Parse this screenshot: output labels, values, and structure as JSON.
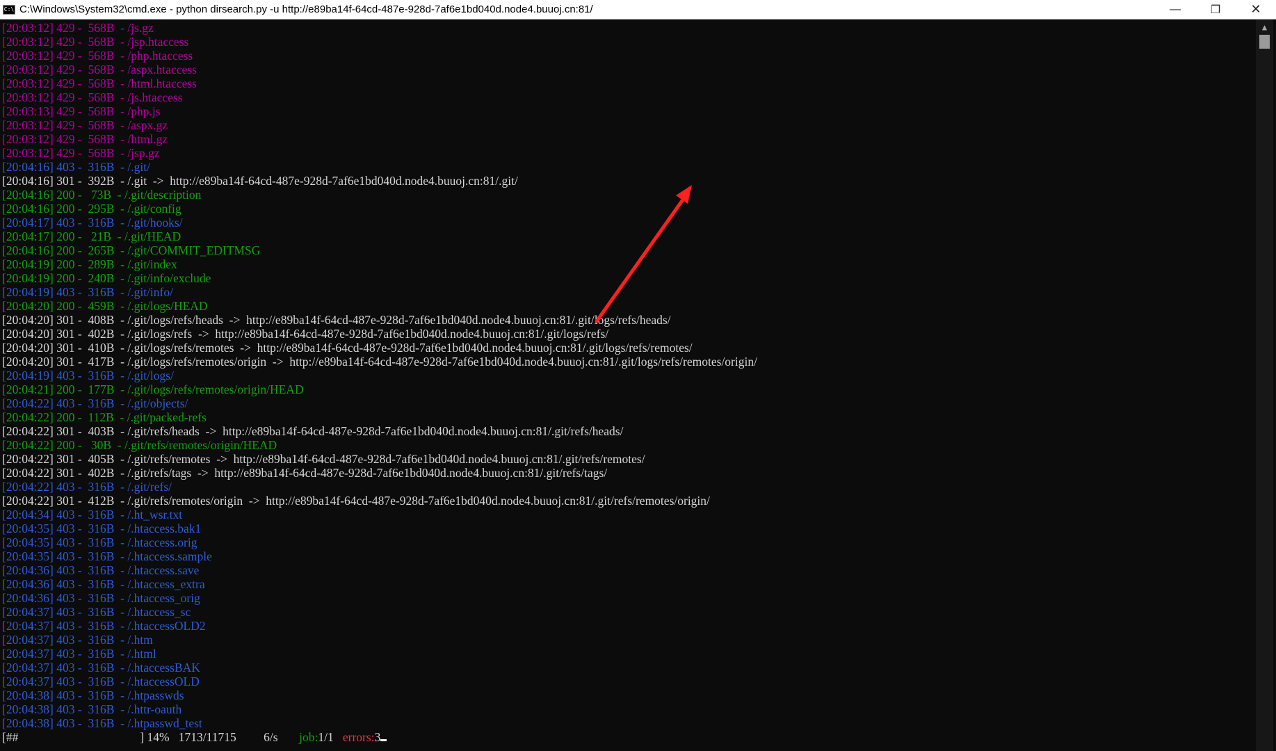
{
  "window": {
    "title": "C:\\Windows\\System32\\cmd.exe - python  dirsearch.py -u http://e89ba14f-64cd-487e-928d-7af6e1bd040d.node4.buuoj.cn:81/",
    "icon_label": "C:\\",
    "minimize": "—",
    "restore": "❐",
    "close": "✕"
  },
  "colors": {
    "background": "#0c0c0c",
    "status_429": "#b4009e",
    "status_403": "#2f5cd8",
    "status_200": "#13a10e",
    "redirect": "#d6d6d6",
    "arrow": "#ff2020"
  },
  "log": [
    {
      "time": "[20:03:12]",
      "code": "429",
      "dash": "-",
      "size": "568B",
      "sep": "-",
      "path": "/js.gz",
      "redirect": "",
      "color": "mag"
    },
    {
      "time": "[20:03:12]",
      "code": "429",
      "dash": "-",
      "size": "568B",
      "sep": "-",
      "path": "/jsp.htaccess",
      "redirect": "",
      "color": "mag"
    },
    {
      "time": "[20:03:12]",
      "code": "429",
      "dash": "-",
      "size": "568B",
      "sep": "-",
      "path": "/php.htaccess",
      "redirect": "",
      "color": "mag"
    },
    {
      "time": "[20:03:12]",
      "code": "429",
      "dash": "-",
      "size": "568B",
      "sep": "-",
      "path": "/aspx.htaccess",
      "redirect": "",
      "color": "mag"
    },
    {
      "time": "[20:03:12]",
      "code": "429",
      "dash": "-",
      "size": "568B",
      "sep": "-",
      "path": "/html.htaccess",
      "redirect": "",
      "color": "mag"
    },
    {
      "time": "[20:03:12]",
      "code": "429",
      "dash": "-",
      "size": "568B",
      "sep": "-",
      "path": "/js.htaccess",
      "redirect": "",
      "color": "mag"
    },
    {
      "time": "[20:03:13]",
      "code": "429",
      "dash": "-",
      "size": "568B",
      "sep": "-",
      "path": "/php.js",
      "redirect": "",
      "color": "mag"
    },
    {
      "time": "[20:03:12]",
      "code": "429",
      "dash": "-",
      "size": "568B",
      "sep": "-",
      "path": "/aspx.gz",
      "redirect": "",
      "color": "mag"
    },
    {
      "time": "[20:03:12]",
      "code": "429",
      "dash": "-",
      "size": "568B",
      "sep": "-",
      "path": "/html.gz",
      "redirect": "",
      "color": "mag"
    },
    {
      "time": "[20:03:12]",
      "code": "429",
      "dash": "-",
      "size": "568B",
      "sep": "-",
      "path": "/jsp.gz",
      "redirect": "",
      "color": "mag"
    },
    {
      "time": "[20:04:16]",
      "code": "403",
      "dash": "-",
      "size": "316B",
      "sep": "-",
      "path": "/.git/",
      "redirect": "",
      "color": "blu"
    },
    {
      "time": "[20:04:16]",
      "code": "301",
      "dash": "-",
      "size": "392B",
      "sep": "-",
      "path": "/.git",
      "redirect": "http://e89ba14f-64cd-487e-928d-7af6e1bd040d.node4.buuoj.cn:81/.git/",
      "color": "wht"
    },
    {
      "time": "[20:04:16]",
      "code": "200",
      "dash": "-",
      "size": " 73B",
      "sep": "-",
      "path": "/.git/description",
      "redirect": "",
      "color": "grn"
    },
    {
      "time": "[20:04:16]",
      "code": "200",
      "dash": "-",
      "size": "295B",
      "sep": "-",
      "path": "/.git/config",
      "redirect": "",
      "color": "grn"
    },
    {
      "time": "[20:04:17]",
      "code": "403",
      "dash": "-",
      "size": "316B",
      "sep": "-",
      "path": "/.git/hooks/",
      "redirect": "",
      "color": "blu"
    },
    {
      "time": "[20:04:17]",
      "code": "200",
      "dash": "-",
      "size": " 21B",
      "sep": "-",
      "path": "/.git/HEAD",
      "redirect": "",
      "color": "grn"
    },
    {
      "time": "[20:04:16]",
      "code": "200",
      "dash": "-",
      "size": "265B",
      "sep": "-",
      "path": "/.git/COMMIT_EDITMSG",
      "redirect": "",
      "color": "grn"
    },
    {
      "time": "[20:04:19]",
      "code": "200",
      "dash": "-",
      "size": "289B",
      "sep": "-",
      "path": "/.git/index",
      "redirect": "",
      "color": "grn"
    },
    {
      "time": "[20:04:19]",
      "code": "200",
      "dash": "-",
      "size": "240B",
      "sep": "-",
      "path": "/.git/info/exclude",
      "redirect": "",
      "color": "grn"
    },
    {
      "time": "[20:04:19]",
      "code": "403",
      "dash": "-",
      "size": "316B",
      "sep": "-",
      "path": "/.git/info/",
      "redirect": "",
      "color": "blu"
    },
    {
      "time": "[20:04:20]",
      "code": "200",
      "dash": "-",
      "size": "459B",
      "sep": "-",
      "path": "/.git/logs/HEAD",
      "redirect": "",
      "color": "grn"
    },
    {
      "time": "[20:04:20]",
      "code": "301",
      "dash": "-",
      "size": "408B",
      "sep": "-",
      "path": "/.git/logs/refs/heads",
      "redirect": "http://e89ba14f-64cd-487e-928d-7af6e1bd040d.node4.buuoj.cn:81/.git/logs/refs/heads/",
      "color": "wht"
    },
    {
      "time": "[20:04:20]",
      "code": "301",
      "dash": "-",
      "size": "402B",
      "sep": "-",
      "path": "/.git/logs/refs",
      "redirect": "http://e89ba14f-64cd-487e-928d-7af6e1bd040d.node4.buuoj.cn:81/.git/logs/refs/",
      "color": "wht"
    },
    {
      "time": "[20:04:20]",
      "code": "301",
      "dash": "-",
      "size": "410B",
      "sep": "-",
      "path": "/.git/logs/refs/remotes",
      "redirect": "http://e89ba14f-64cd-487e-928d-7af6e1bd040d.node4.buuoj.cn:81/.git/logs/refs/remotes/",
      "color": "wht"
    },
    {
      "time": "[20:04:20]",
      "code": "301",
      "dash": "-",
      "size": "417B",
      "sep": "-",
      "path": "/.git/logs/refs/remotes/origin",
      "redirect": "http://e89ba14f-64cd-487e-928d-7af6e1bd040d.node4.buuoj.cn:81/.git/logs/refs/remotes/origin/",
      "color": "wht"
    },
    {
      "time": "[20:04:19]",
      "code": "403",
      "dash": "-",
      "size": "316B",
      "sep": "-",
      "path": "/.git/logs/",
      "redirect": "",
      "color": "blu"
    },
    {
      "time": "[20:04:21]",
      "code": "200",
      "dash": "-",
      "size": "177B",
      "sep": "-",
      "path": "/.git/logs/refs/remotes/origin/HEAD",
      "redirect": "",
      "color": "grn"
    },
    {
      "time": "[20:04:22]",
      "code": "403",
      "dash": "-",
      "size": "316B",
      "sep": "-",
      "path": "/.git/objects/",
      "redirect": "",
      "color": "blu"
    },
    {
      "time": "[20:04:22]",
      "code": "200",
      "dash": "-",
      "size": "112B",
      "sep": "-",
      "path": "/.git/packed-refs",
      "redirect": "",
      "color": "grn"
    },
    {
      "time": "[20:04:22]",
      "code": "301",
      "dash": "-",
      "size": "403B",
      "sep": "-",
      "path": "/.git/refs/heads",
      "redirect": "http://e89ba14f-64cd-487e-928d-7af6e1bd040d.node4.buuoj.cn:81/.git/refs/heads/",
      "color": "wht"
    },
    {
      "time": "[20:04:22]",
      "code": "200",
      "dash": "-",
      "size": " 30B",
      "sep": "-",
      "path": "/.git/refs/remotes/origin/HEAD",
      "redirect": "",
      "color": "grn"
    },
    {
      "time": "[20:04:22]",
      "code": "301",
      "dash": "-",
      "size": "405B",
      "sep": "-",
      "path": "/.git/refs/remotes",
      "redirect": "http://e89ba14f-64cd-487e-928d-7af6e1bd040d.node4.buuoj.cn:81/.git/refs/remotes/",
      "color": "wht"
    },
    {
      "time": "[20:04:22]",
      "code": "301",
      "dash": "-",
      "size": "402B",
      "sep": "-",
      "path": "/.git/refs/tags",
      "redirect": "http://e89ba14f-64cd-487e-928d-7af6e1bd040d.node4.buuoj.cn:81/.git/refs/tags/",
      "color": "wht"
    },
    {
      "time": "[20:04:22]",
      "code": "403",
      "dash": "-",
      "size": "316B",
      "sep": "-",
      "path": "/.git/refs/",
      "redirect": "",
      "color": "blu"
    },
    {
      "time": "[20:04:22]",
      "code": "301",
      "dash": "-",
      "size": "412B",
      "sep": "-",
      "path": "/.git/refs/remotes/origin",
      "redirect": "http://e89ba14f-64cd-487e-928d-7af6e1bd040d.node4.buuoj.cn:81/.git/refs/remotes/origin/",
      "color": "wht"
    },
    {
      "time": "[20:04:34]",
      "code": "403",
      "dash": "-",
      "size": "316B",
      "sep": "-",
      "path": "/.ht_wsr.txt",
      "redirect": "",
      "color": "blu"
    },
    {
      "time": "[20:04:35]",
      "code": "403",
      "dash": "-",
      "size": "316B",
      "sep": "-",
      "path": "/.htaccess.bak1",
      "redirect": "",
      "color": "blu"
    },
    {
      "time": "[20:04:35]",
      "code": "403",
      "dash": "-",
      "size": "316B",
      "sep": "-",
      "path": "/.htaccess.orig",
      "redirect": "",
      "color": "blu"
    },
    {
      "time": "[20:04:35]",
      "code": "403",
      "dash": "-",
      "size": "316B",
      "sep": "-",
      "path": "/.htaccess.sample",
      "redirect": "",
      "color": "blu"
    },
    {
      "time": "[20:04:36]",
      "code": "403",
      "dash": "-",
      "size": "316B",
      "sep": "-",
      "path": "/.htaccess.save",
      "redirect": "",
      "color": "blu"
    },
    {
      "time": "[20:04:36]",
      "code": "403",
      "dash": "-",
      "size": "316B",
      "sep": "-",
      "path": "/.htaccess_extra",
      "redirect": "",
      "color": "blu"
    },
    {
      "time": "[20:04:36]",
      "code": "403",
      "dash": "-",
      "size": "316B",
      "sep": "-",
      "path": "/.htaccess_orig",
      "redirect": "",
      "color": "blu"
    },
    {
      "time": "[20:04:37]",
      "code": "403",
      "dash": "-",
      "size": "316B",
      "sep": "-",
      "path": "/.htaccess_sc",
      "redirect": "",
      "color": "blu"
    },
    {
      "time": "[20:04:37]",
      "code": "403",
      "dash": "-",
      "size": "316B",
      "sep": "-",
      "path": "/.htaccessOLD2",
      "redirect": "",
      "color": "blu"
    },
    {
      "time": "[20:04:37]",
      "code": "403",
      "dash": "-",
      "size": "316B",
      "sep": "-",
      "path": "/.htm",
      "redirect": "",
      "color": "blu"
    },
    {
      "time": "[20:04:37]",
      "code": "403",
      "dash": "-",
      "size": "316B",
      "sep": "-",
      "path": "/.html",
      "redirect": "",
      "color": "blu"
    },
    {
      "time": "[20:04:37]",
      "code": "403",
      "dash": "-",
      "size": "316B",
      "sep": "-",
      "path": "/.htaccessBAK",
      "redirect": "",
      "color": "blu"
    },
    {
      "time": "[20:04:37]",
      "code": "403",
      "dash": "-",
      "size": "316B",
      "sep": "-",
      "path": "/.htaccessOLD",
      "redirect": "",
      "color": "blu"
    },
    {
      "time": "[20:04:38]",
      "code": "403",
      "dash": "-",
      "size": "316B",
      "sep": "-",
      "path": "/.htpasswds",
      "redirect": "",
      "color": "blu"
    },
    {
      "time": "[20:04:38]",
      "code": "403",
      "dash": "-",
      "size": "316B",
      "sep": "-",
      "path": "/.httr-oauth",
      "redirect": "",
      "color": "blu"
    },
    {
      "time": "[20:04:38]",
      "code": "403",
      "dash": "-",
      "size": "316B",
      "sep": "-",
      "path": "/.htpasswd_test",
      "redirect": "",
      "color": "blu"
    }
  ],
  "redirect_arrow": "->",
  "status": {
    "bar": "[##",
    "bar_end": "]",
    "percent": "14%",
    "count": "1713/11715",
    "rate": "6/s",
    "job_label": "job:",
    "job_value": "1/1",
    "errors_label": "errors:",
    "errors_value": "3"
  }
}
